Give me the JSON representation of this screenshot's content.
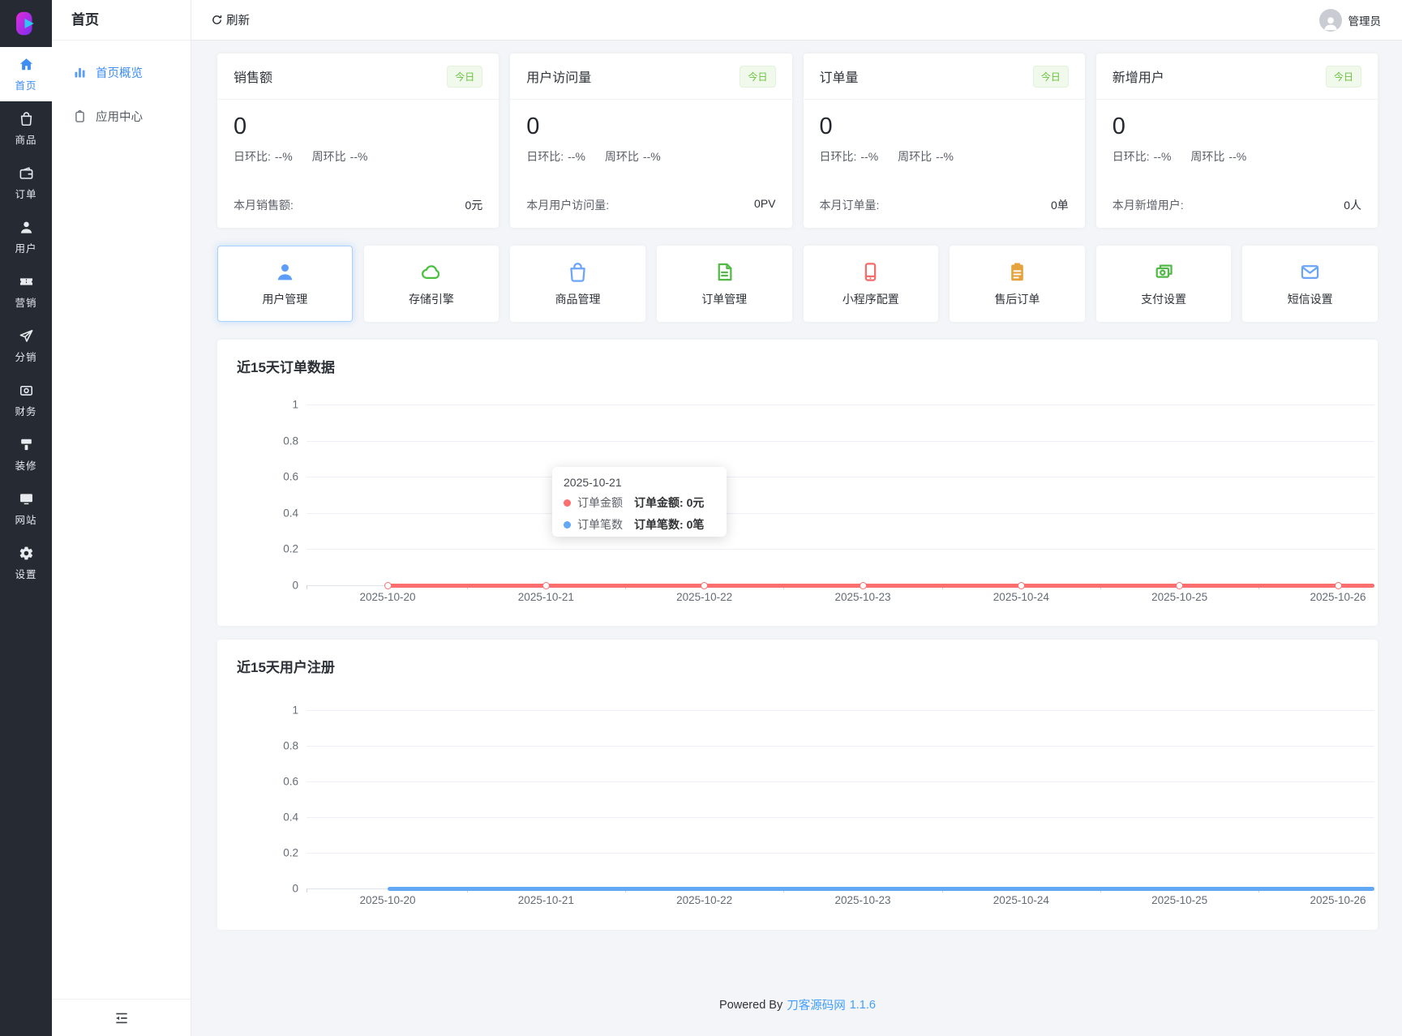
{
  "header": {
    "refresh_label": "刷新",
    "user_label": "管理员"
  },
  "sidebar": {
    "items": [
      {
        "key": "home",
        "label": "首页",
        "icon": "home-icon",
        "active": true
      },
      {
        "key": "goods",
        "label": "商品",
        "icon": "goods-icon",
        "active": false
      },
      {
        "key": "orders",
        "label": "订单",
        "icon": "order-icon",
        "active": false
      },
      {
        "key": "users",
        "label": "用户",
        "icon": "user-icon",
        "active": false
      },
      {
        "key": "marketing",
        "label": "营销",
        "icon": "marketing-icon",
        "active": false
      },
      {
        "key": "distribution",
        "label": "分销",
        "icon": "distribution-icon",
        "active": false
      },
      {
        "key": "finance",
        "label": "财务",
        "icon": "finance-icon",
        "active": false
      },
      {
        "key": "decoration",
        "label": "装修",
        "icon": "decoration-icon",
        "active": false
      },
      {
        "key": "website",
        "label": "网站",
        "icon": "website-icon",
        "active": false
      },
      {
        "key": "settings",
        "label": "设置",
        "icon": "settings-icon",
        "active": false
      }
    ]
  },
  "submenu": {
    "title": "首页",
    "items": [
      {
        "key": "overview",
        "label": "首页概览",
        "icon": "chart-bar-icon",
        "active": true
      },
      {
        "key": "app-center",
        "label": "应用中心",
        "icon": "app-center-icon",
        "active": false
      }
    ]
  },
  "stat_cards": [
    {
      "key": "sales",
      "title": "销售额",
      "badge": "今日",
      "value": "0",
      "day_label": "日环比:",
      "day_value": "--%",
      "week_label": "周环比",
      "week_value": "--%",
      "month_label": "本月销售额:",
      "month_value": "0元"
    },
    {
      "key": "visits",
      "title": "用户访问量",
      "badge": "今日",
      "value": "0",
      "day_label": "日环比:",
      "day_value": "--%",
      "week_label": "周环比",
      "week_value": "--%",
      "month_label": "本月用户访问量:",
      "month_value": "0PV"
    },
    {
      "key": "orders",
      "title": "订单量",
      "badge": "今日",
      "value": "0",
      "day_label": "日环比:",
      "day_value": "--%",
      "week_label": "周环比",
      "week_value": "--%",
      "month_label": "本月订单量:",
      "month_value": "0单"
    },
    {
      "key": "new-users",
      "title": "新增用户",
      "badge": "今日",
      "value": "0",
      "day_label": "日环比:",
      "day_value": "--%",
      "week_label": "周环比",
      "week_value": "--%",
      "month_label": "本月新增用户:",
      "month_value": "0人"
    }
  ],
  "shortcuts": [
    {
      "key": "user-management",
      "label": "用户管理",
      "icon": "person-icon",
      "color": "#5b9df9",
      "active": true
    },
    {
      "key": "storage-engine",
      "label": "存储引擎",
      "icon": "cloud-icon",
      "color": "#49c13d",
      "active": false
    },
    {
      "key": "goods-management",
      "label": "商品管理",
      "icon": "bag-icon",
      "color": "#6aa5f8",
      "active": false
    },
    {
      "key": "order-management",
      "label": "订单管理",
      "icon": "document-icon",
      "color": "#52b946",
      "active": false
    },
    {
      "key": "miniprogram-config",
      "label": "小程序配置",
      "icon": "phone-icon",
      "color": "#f56c6c",
      "active": false
    },
    {
      "key": "aftersale-orders",
      "label": "售后订单",
      "icon": "clipboard-icon",
      "color": "#e6a23c",
      "active": false
    },
    {
      "key": "payment-settings",
      "label": "支付设置",
      "icon": "money-icon",
      "color": "#52b946",
      "active": false
    },
    {
      "key": "sms-settings",
      "label": "短信设置",
      "icon": "mail-icon",
      "color": "#6aa5f8",
      "active": false
    }
  ],
  "chart_data": [
    {
      "type": "line",
      "title": "近15天订单数据",
      "x": [
        "2025-10-20",
        "2025-10-21",
        "2025-10-22",
        "2025-10-23",
        "2025-10-24",
        "2025-10-25",
        "2025-10-26"
      ],
      "series": [
        {
          "name": "订单金额",
          "color": "#fb6f6f",
          "values": [
            0,
            0,
            0,
            0,
            0,
            0,
            0
          ],
          "unit": "元"
        },
        {
          "name": "订单笔数",
          "color": "#63a8f5",
          "values": [
            0,
            0,
            0,
            0,
            0,
            0,
            0
          ],
          "unit": "笔"
        }
      ],
      "ylim": [
        0,
        1
      ],
      "yticks": [
        1,
        0.8,
        0.6,
        0.4,
        0.2,
        0
      ],
      "grid": true,
      "markers": true,
      "legend_position": "none",
      "tooltip": {
        "date": "2025-10-21",
        "rows": [
          {
            "series": "订单金额",
            "label": "订单金额:",
            "value": "0元"
          },
          {
            "series": "订单笔数",
            "label": "订单笔数:",
            "value": "0笔"
          }
        ]
      }
    },
    {
      "type": "line",
      "title": "近15天用户注册",
      "x": [
        "2025-10-20",
        "2025-10-21",
        "2025-10-22",
        "2025-10-23",
        "2025-10-24",
        "2025-10-25",
        "2025-10-26"
      ],
      "series": [
        {
          "name": "用户注册",
          "color": "#63a8f5",
          "values": [
            0,
            0,
            0,
            0,
            0,
            0,
            0
          ],
          "unit": "人"
        }
      ],
      "ylim": [
        0,
        1
      ],
      "yticks": [
        1,
        0.8,
        0.6,
        0.4,
        0.2,
        0
      ],
      "grid": true,
      "markers": false,
      "legend_position": "none"
    }
  ],
  "footer": {
    "powered_by": "Powered By",
    "brand": "刀客源码网",
    "version": "1.1.6"
  }
}
